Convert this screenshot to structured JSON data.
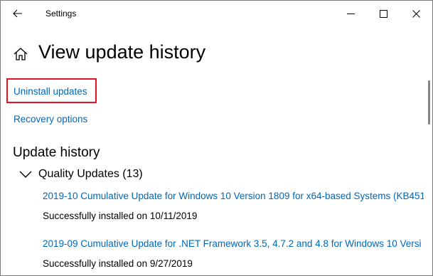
{
  "window": {
    "title": "Settings"
  },
  "header": {
    "title": "View update history"
  },
  "links": {
    "uninstall_updates": "Uninstall updates",
    "recovery_options": "Recovery options"
  },
  "history": {
    "title": "Update history",
    "groups": [
      {
        "label": "Quality Updates (13)",
        "expanded": true,
        "items": [
          {
            "title": "2019-10 Cumulative Update for Windows 10 Version 1809 for x64-based Systems (KB451",
            "status": "Successfully installed on 10/11/2019"
          },
          {
            "title": "2019-09 Cumulative Update for .NET Framework 3.5, 4.7.2 and 4.8 for Windows 10 Versi",
            "status": "Successfully installed on 9/27/2019"
          }
        ]
      }
    ]
  },
  "icons": {
    "back": "back-arrow-icon",
    "home": "home-icon",
    "minimize": "minimize-icon",
    "maximize": "maximize-icon",
    "close": "close-icon",
    "chevron": "chevron-down-icon"
  },
  "colors": {
    "link": "#0067b8",
    "highlight_border": "#e81123",
    "window_border": "#7a7a7a",
    "background": "#ffffff"
  }
}
